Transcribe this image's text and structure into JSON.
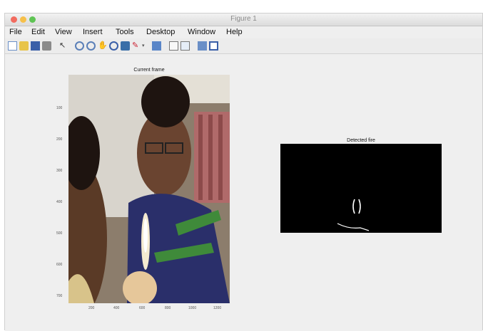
{
  "window": {
    "title": "Figure 1"
  },
  "menu": [
    "File",
    "Edit",
    "View",
    "Insert",
    "Tools",
    "Desktop",
    "Window",
    "Help"
  ],
  "toolbar": {
    "icons": [
      "new-figure-icon",
      "open-file-icon",
      "save-icon",
      "print-icon",
      "edit-plot-icon",
      "zoom-in-icon",
      "zoom-out-icon",
      "pan-icon",
      "rotate-3d-icon",
      "data-cursor-icon",
      "brush-icon",
      "brush-dropdown-icon",
      "link-plot-icon",
      "insert-colorbar-icon",
      "insert-legend-icon",
      "hide-plot-tools-icon",
      "show-plot-tools-icon"
    ]
  },
  "axes_left": {
    "title": "Current frame",
    "y_ticks": [
      "100",
      "200",
      "300",
      "400",
      "500",
      "600",
      "700"
    ],
    "x_ticks": [
      "200",
      "400",
      "600",
      "800",
      "1000",
      "1200"
    ]
  },
  "axes_right": {
    "title": "Detected fire"
  }
}
